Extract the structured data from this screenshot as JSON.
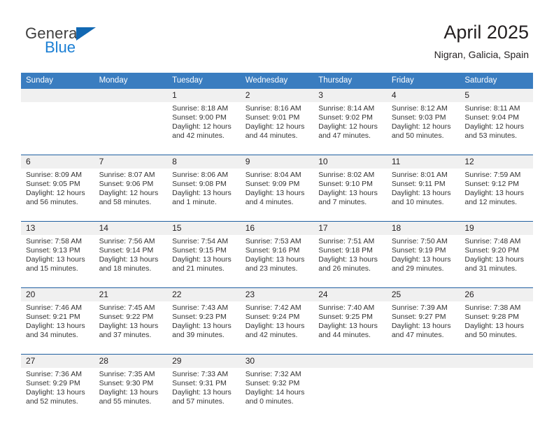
{
  "logo": {
    "text_top": "General",
    "text_bottom": "Blue",
    "triangle_icon": "triangle-icon",
    "color_dark": "#3f3f3f",
    "color_blue": "#1b7fd4"
  },
  "header": {
    "title": "April 2025",
    "subtitle": "Nigran, Galicia, Spain"
  },
  "theme": {
    "header_row_bg": "#3a7dc0",
    "daynum_bg": "#f0f0f0",
    "week_divider": "#1f5fa0",
    "text": "#231f20"
  },
  "calendar": {
    "weekday_headers": [
      "Sunday",
      "Monday",
      "Tuesday",
      "Wednesday",
      "Thursday",
      "Friday",
      "Saturday"
    ],
    "labels": {
      "sunrise": "Sunrise:",
      "sunset": "Sunset:",
      "daylight": "Daylight:"
    },
    "weeks": [
      [
        {
          "day": "",
          "sunrise": "",
          "sunset": "",
          "daylight1": "",
          "daylight2": ""
        },
        {
          "day": "",
          "sunrise": "",
          "sunset": "",
          "daylight1": "",
          "daylight2": ""
        },
        {
          "day": "1",
          "sunrise": "Sunrise: 8:18 AM",
          "sunset": "Sunset: 9:00 PM",
          "daylight1": "Daylight: 12 hours",
          "daylight2": "and 42 minutes."
        },
        {
          "day": "2",
          "sunrise": "Sunrise: 8:16 AM",
          "sunset": "Sunset: 9:01 PM",
          "daylight1": "Daylight: 12 hours",
          "daylight2": "and 44 minutes."
        },
        {
          "day": "3",
          "sunrise": "Sunrise: 8:14 AM",
          "sunset": "Sunset: 9:02 PM",
          "daylight1": "Daylight: 12 hours",
          "daylight2": "and 47 minutes."
        },
        {
          "day": "4",
          "sunrise": "Sunrise: 8:12 AM",
          "sunset": "Sunset: 9:03 PM",
          "daylight1": "Daylight: 12 hours",
          "daylight2": "and 50 minutes."
        },
        {
          "day": "5",
          "sunrise": "Sunrise: 8:11 AM",
          "sunset": "Sunset: 9:04 PM",
          "daylight1": "Daylight: 12 hours",
          "daylight2": "and 53 minutes."
        }
      ],
      [
        {
          "day": "6",
          "sunrise": "Sunrise: 8:09 AM",
          "sunset": "Sunset: 9:05 PM",
          "daylight1": "Daylight: 12 hours",
          "daylight2": "and 56 minutes."
        },
        {
          "day": "7",
          "sunrise": "Sunrise: 8:07 AM",
          "sunset": "Sunset: 9:06 PM",
          "daylight1": "Daylight: 12 hours",
          "daylight2": "and 58 minutes."
        },
        {
          "day": "8",
          "sunrise": "Sunrise: 8:06 AM",
          "sunset": "Sunset: 9:08 PM",
          "daylight1": "Daylight: 13 hours",
          "daylight2": "and 1 minute."
        },
        {
          "day": "9",
          "sunrise": "Sunrise: 8:04 AM",
          "sunset": "Sunset: 9:09 PM",
          "daylight1": "Daylight: 13 hours",
          "daylight2": "and 4 minutes."
        },
        {
          "day": "10",
          "sunrise": "Sunrise: 8:02 AM",
          "sunset": "Sunset: 9:10 PM",
          "daylight1": "Daylight: 13 hours",
          "daylight2": "and 7 minutes."
        },
        {
          "day": "11",
          "sunrise": "Sunrise: 8:01 AM",
          "sunset": "Sunset: 9:11 PM",
          "daylight1": "Daylight: 13 hours",
          "daylight2": "and 10 minutes."
        },
        {
          "day": "12",
          "sunrise": "Sunrise: 7:59 AM",
          "sunset": "Sunset: 9:12 PM",
          "daylight1": "Daylight: 13 hours",
          "daylight2": "and 12 minutes."
        }
      ],
      [
        {
          "day": "13",
          "sunrise": "Sunrise: 7:58 AM",
          "sunset": "Sunset: 9:13 PM",
          "daylight1": "Daylight: 13 hours",
          "daylight2": "and 15 minutes."
        },
        {
          "day": "14",
          "sunrise": "Sunrise: 7:56 AM",
          "sunset": "Sunset: 9:14 PM",
          "daylight1": "Daylight: 13 hours",
          "daylight2": "and 18 minutes."
        },
        {
          "day": "15",
          "sunrise": "Sunrise: 7:54 AM",
          "sunset": "Sunset: 9:15 PM",
          "daylight1": "Daylight: 13 hours",
          "daylight2": "and 21 minutes."
        },
        {
          "day": "16",
          "sunrise": "Sunrise: 7:53 AM",
          "sunset": "Sunset: 9:16 PM",
          "daylight1": "Daylight: 13 hours",
          "daylight2": "and 23 minutes."
        },
        {
          "day": "17",
          "sunrise": "Sunrise: 7:51 AM",
          "sunset": "Sunset: 9:18 PM",
          "daylight1": "Daylight: 13 hours",
          "daylight2": "and 26 minutes."
        },
        {
          "day": "18",
          "sunrise": "Sunrise: 7:50 AM",
          "sunset": "Sunset: 9:19 PM",
          "daylight1": "Daylight: 13 hours",
          "daylight2": "and 29 minutes."
        },
        {
          "day": "19",
          "sunrise": "Sunrise: 7:48 AM",
          "sunset": "Sunset: 9:20 PM",
          "daylight1": "Daylight: 13 hours",
          "daylight2": "and 31 minutes."
        }
      ],
      [
        {
          "day": "20",
          "sunrise": "Sunrise: 7:46 AM",
          "sunset": "Sunset: 9:21 PM",
          "daylight1": "Daylight: 13 hours",
          "daylight2": "and 34 minutes."
        },
        {
          "day": "21",
          "sunrise": "Sunrise: 7:45 AM",
          "sunset": "Sunset: 9:22 PM",
          "daylight1": "Daylight: 13 hours",
          "daylight2": "and 37 minutes."
        },
        {
          "day": "22",
          "sunrise": "Sunrise: 7:43 AM",
          "sunset": "Sunset: 9:23 PM",
          "daylight1": "Daylight: 13 hours",
          "daylight2": "and 39 minutes."
        },
        {
          "day": "23",
          "sunrise": "Sunrise: 7:42 AM",
          "sunset": "Sunset: 9:24 PM",
          "daylight1": "Daylight: 13 hours",
          "daylight2": "and 42 minutes."
        },
        {
          "day": "24",
          "sunrise": "Sunrise: 7:40 AM",
          "sunset": "Sunset: 9:25 PM",
          "daylight1": "Daylight: 13 hours",
          "daylight2": "and 44 minutes."
        },
        {
          "day": "25",
          "sunrise": "Sunrise: 7:39 AM",
          "sunset": "Sunset: 9:27 PM",
          "daylight1": "Daylight: 13 hours",
          "daylight2": "and 47 minutes."
        },
        {
          "day": "26",
          "sunrise": "Sunrise: 7:38 AM",
          "sunset": "Sunset: 9:28 PM",
          "daylight1": "Daylight: 13 hours",
          "daylight2": "and 50 minutes."
        }
      ],
      [
        {
          "day": "27",
          "sunrise": "Sunrise: 7:36 AM",
          "sunset": "Sunset: 9:29 PM",
          "daylight1": "Daylight: 13 hours",
          "daylight2": "and 52 minutes."
        },
        {
          "day": "28",
          "sunrise": "Sunrise: 7:35 AM",
          "sunset": "Sunset: 9:30 PM",
          "daylight1": "Daylight: 13 hours",
          "daylight2": "and 55 minutes."
        },
        {
          "day": "29",
          "sunrise": "Sunrise: 7:33 AM",
          "sunset": "Sunset: 9:31 PM",
          "daylight1": "Daylight: 13 hours",
          "daylight2": "and 57 minutes."
        },
        {
          "day": "30",
          "sunrise": "Sunrise: 7:32 AM",
          "sunset": "Sunset: 9:32 PM",
          "daylight1": "Daylight: 14 hours",
          "daylight2": "and 0 minutes."
        },
        {
          "day": "",
          "sunrise": "",
          "sunset": "",
          "daylight1": "",
          "daylight2": ""
        },
        {
          "day": "",
          "sunrise": "",
          "sunset": "",
          "daylight1": "",
          "daylight2": ""
        },
        {
          "day": "",
          "sunrise": "",
          "sunset": "",
          "daylight1": "",
          "daylight2": ""
        }
      ]
    ]
  }
}
